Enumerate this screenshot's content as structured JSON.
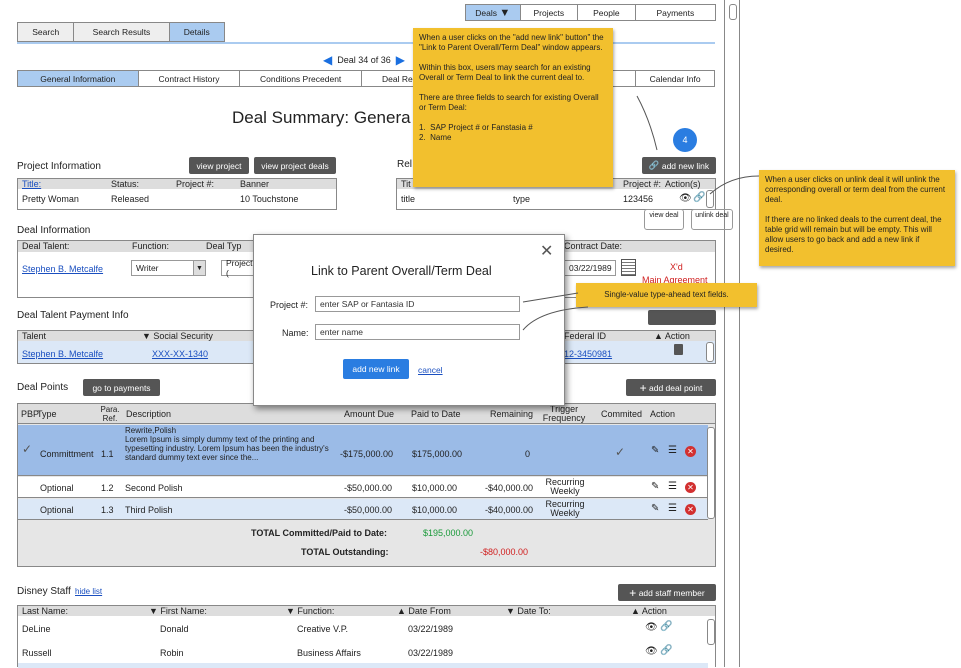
{
  "topnav": [
    "Deals",
    "Projects",
    "People",
    "Payments"
  ],
  "subtabs": [
    "Search",
    "Search Results",
    "Details"
  ],
  "pager": "Deal 34 of 36",
  "infotabs": [
    "General Information",
    "Contract History",
    "Conditions Precedent",
    "Deal Re",
    "Calendar Info"
  ],
  "page_title": "Deal Summary:  Genera",
  "project": {
    "heading": "Project Information",
    "view_project": "view project",
    "view_deals": "view project deals",
    "cols": [
      "Title:",
      "Status:",
      "Project #:",
      "Banner"
    ],
    "row": [
      "Pretty Woman",
      "Released",
      "10 Touchstone"
    ]
  },
  "related": {
    "heading": "Rel",
    "add_new_link": "add new link",
    "cols": [
      "Tit",
      "Project #:",
      "Action(s)"
    ],
    "row": [
      "title",
      "type",
      "123456"
    ],
    "badge": "4"
  },
  "deal_info": {
    "heading": "Deal Information",
    "cols": [
      "Deal Talent:",
      "Function:",
      "Deal Typ",
      "Contract Date:"
    ],
    "talent": "Stephen B. Metcalfe",
    "function": "Writer",
    "deal_type": "Project (",
    "contract_date": "03/22/1989",
    "xd": "X'd",
    "main_agreement": "Main Agreement"
  },
  "payment": {
    "heading": "Deal Talent Payment Info",
    "cols": [
      "Talent",
      "▼ Social Security",
      "Federal ID",
      "▲ Action"
    ],
    "talent": "Stephen B. Metcalfe",
    "ssn": "XXX-XX-1340",
    "fed": "12-3450981"
  },
  "points": {
    "heading": "Deal Points",
    "go_payments": "go to payments",
    "add_point": "add deal point",
    "cols": [
      "PBP",
      "Type",
      "Para. Ref.",
      "Description",
      "Amount Due",
      "Paid to Date",
      "Remaining",
      "Trigger Frequency",
      "Commited",
      "Action"
    ],
    "rows": [
      {
        "type": "Committment",
        "ref": "1.1",
        "desc": "Rewrite,Polish\nLorem Ipsum is simply dummy text of the printing and typesetting industry. Lorem Ipsum has been the industry's standard dummy text ever since the...",
        "due": "-$175,000.00",
        "paid": "$175,000.00",
        "rem": "0",
        "trig": ""
      },
      {
        "type": "Optional",
        "ref": "1.2",
        "desc": "Second Polish",
        "due": "-$50,000.00",
        "paid": "$10,000.00",
        "rem": "-$40,000.00",
        "trig": "Recurring Weekly"
      },
      {
        "type": "Optional",
        "ref": "1.3",
        "desc": "Third Polish",
        "due": "-$50,000.00",
        "paid": "$10,000.00",
        "rem": "-$40,000.00",
        "trig": "Recurring Weekly"
      }
    ],
    "total_label": "TOTAL Committed/Paid to Date:",
    "total_value": "$195,000.00",
    "outstanding_label": "TOTAL Outstanding:",
    "outstanding_value": "-$80,000.00"
  },
  "staff": {
    "heading": "Disney Staff",
    "hide": "hide list",
    "add": "add staff member",
    "cols": [
      "Last Name:",
      "▼ First Name:",
      "▼ Function:",
      "▲ Date From",
      "▼ Date To:",
      "▲ Action"
    ],
    "rows": [
      [
        "DeLine",
        "Donald",
        "Creative V.P.",
        "03/22/1989"
      ],
      [
        "Russell",
        "Robin",
        "Business Affairs",
        "03/22/1989"
      ]
    ]
  },
  "modal": {
    "title": "Link to Parent Overall/Term Deal",
    "project_label": "Project #:",
    "project_placeholder": "enter SAP or Fantasia ID",
    "name_label": "Name:",
    "name_placeholder": "enter name",
    "add": "add new link",
    "cancel": "cancel"
  },
  "notes": {
    "n1": [
      "When a user clicks on the \"add new link\" button\" the \"Link to Parent Overall/Term Deal\" window appears.",
      "Within this box, users may search for an existing Overall or Term Deal to link the current deal to.",
      "There are three fields to search for existing Overall or Term Deal:",
      "1.  SAP Project # or Fanstasia #\n2.  Name"
    ],
    "n2": [
      "When a user clicks on unlink deal it will unlink the corresponding overall or term deal from the current deal.",
      "If there are no linked deals to the current deal, the table grid will remain but will be empty.  This will allow users to go back and add a new link if desired."
    ],
    "n3": "Single-value type-ahead text fields.",
    "view_deal": "view deal",
    "unlink_deal": "unlink deal"
  }
}
